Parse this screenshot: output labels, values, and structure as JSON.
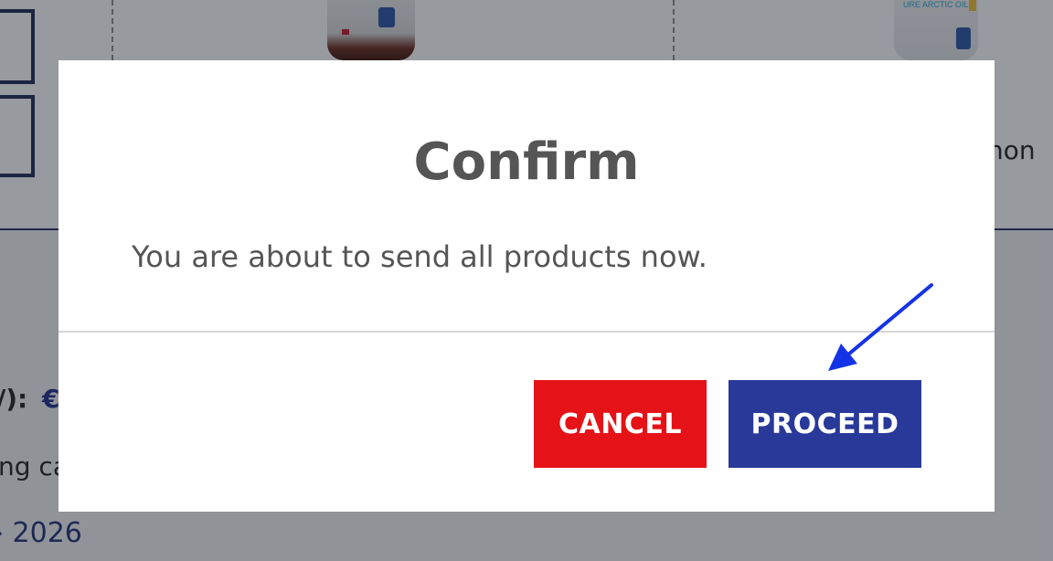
{
  "background": {
    "product_2_name_fragment": "non",
    "product_2_label_fragment": "URE ARCTIC OIL",
    "summary_label_fragment": "/):",
    "summary_value_fragment": "€",
    "shipping_fragment": "ng ca",
    "date_fragment": "› 2026"
  },
  "modal": {
    "title": "Confirm",
    "message": "You are about to send all products now.",
    "cancel_label": "CANCEL",
    "proceed_label": "PROCEED"
  },
  "colors": {
    "cancel": "#e51317",
    "proceed": "#28399a",
    "annotation_arrow": "#1433e6"
  }
}
